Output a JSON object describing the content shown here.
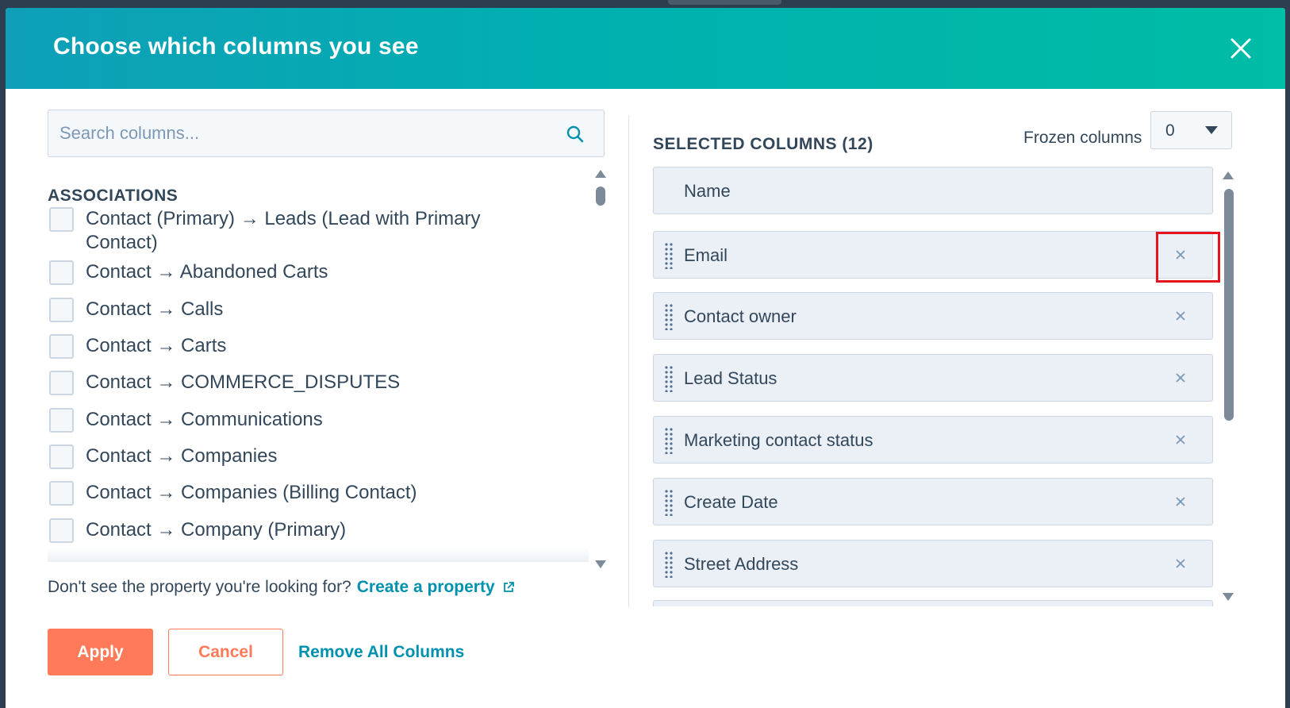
{
  "modal": {
    "title": "Choose which columns you see"
  },
  "search": {
    "placeholder": "Search columns..."
  },
  "associations": {
    "heading": "ASSOCIATIONS",
    "items": [
      {
        "label": "Contact (Primary) → Leads (Lead with Primary Contact)",
        "checked": false
      },
      {
        "label": "Contact → Abandoned Carts",
        "checked": false
      },
      {
        "label": "Contact → Calls",
        "checked": false
      },
      {
        "label": "Contact → Carts",
        "checked": false
      },
      {
        "label": "Contact → COMMERCE_DISPUTES",
        "checked": false
      },
      {
        "label": "Contact → Communications",
        "checked": false
      },
      {
        "label": "Contact → Companies",
        "checked": false
      },
      {
        "label": "Contact → Companies (Billing Contact)",
        "checked": false
      },
      {
        "label": "Contact → Company (Primary)",
        "checked": false
      }
    ]
  },
  "help": {
    "text": "Don't see the property you're looking for?",
    "link": "Create a property"
  },
  "selected": {
    "heading": "SELECTED COLUMNS (12)",
    "frozen_label": "Frozen columns",
    "frozen_value": "0",
    "columns": [
      {
        "label": "Name",
        "removable": false
      },
      {
        "label": "Email",
        "removable": true
      },
      {
        "label": "Contact owner",
        "removable": true
      },
      {
        "label": "Lead Status",
        "removable": true
      },
      {
        "label": "Marketing contact status",
        "removable": true
      },
      {
        "label": "Create Date",
        "removable": true
      },
      {
        "label": "Street Address",
        "removable": true
      }
    ]
  },
  "footer": {
    "apply": "Apply",
    "cancel": "Cancel",
    "remove_all": "Remove All Columns"
  },
  "colors": {
    "header_gradient_start": "#0f9fb8",
    "header_gradient_end": "#00bda5",
    "primary_button": "#ff7a59",
    "link": "#0091ae",
    "highlight": "#e5141e",
    "text": "#33475b"
  },
  "icons": {
    "close": "close-icon",
    "search": "search-icon",
    "caret": "caret-down-icon",
    "drag": "drag-handle-icon",
    "remove": "remove-icon",
    "external": "external-link-icon"
  }
}
